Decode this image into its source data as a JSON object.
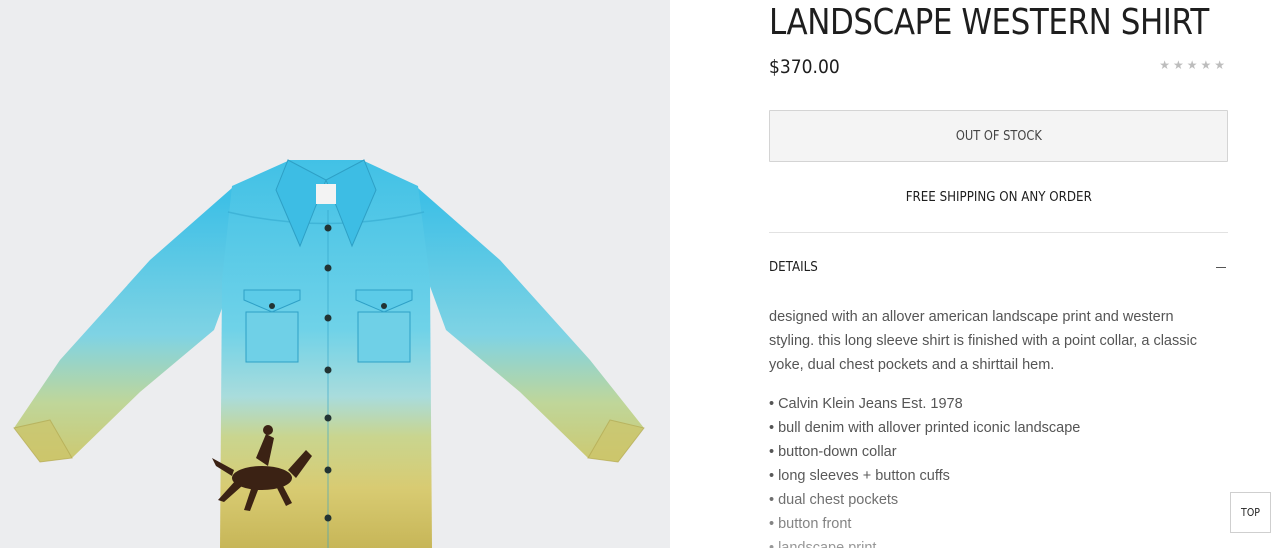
{
  "product": {
    "title": "LANDSCAPE WESTERN SHIRT",
    "price": "$370.00",
    "rating_stars": "★★★★★",
    "stock_button": "OUT OF STOCK",
    "shipping_note": "FREE SHIPPING ON ANY ORDER"
  },
  "details": {
    "label": "DETAILS",
    "description": "designed with an allover american landscape print and western styling. this long sleeve shirt is finished with a point collar, a classic yoke, dual chest pockets and a shirttail hem.",
    "features": [
      "Calvin Klein Jeans Est. 1978",
      "bull denim with allover printed iconic landscape",
      "button-down collar",
      "long sleeves + button cuffs",
      "dual chest pockets",
      "button front",
      "landscape print"
    ]
  },
  "scroll_top": {
    "label": "TOP"
  },
  "icons": {
    "collapse": "minus-icon",
    "rating": "star-icon"
  },
  "colors": {
    "sky": "#45c3e6",
    "sand": "#c9c36a",
    "text": "#1e1e1e",
    "body_text": "#555555"
  }
}
